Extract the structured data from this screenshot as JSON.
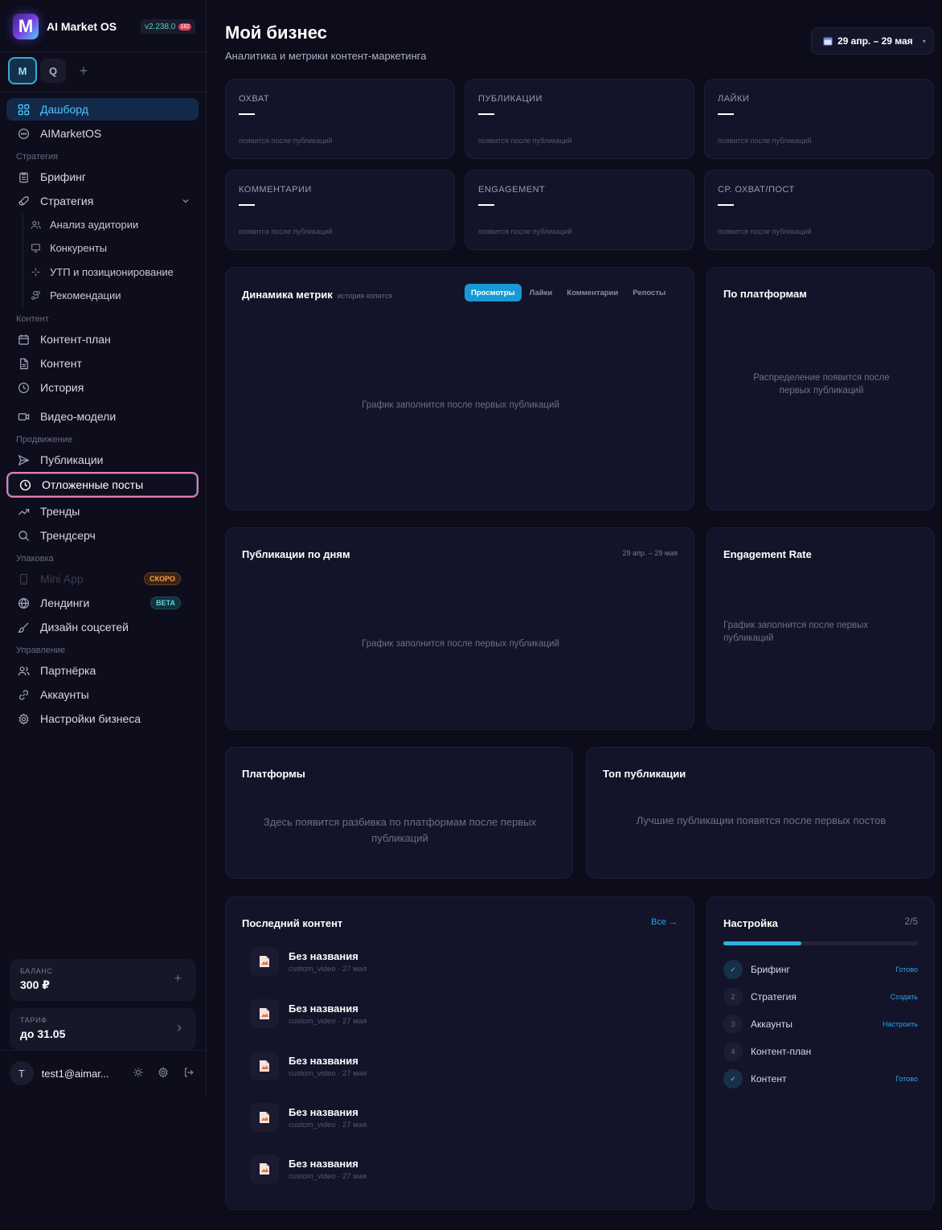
{
  "brand": {
    "logo": "M",
    "name": "AI Market OS",
    "version": "v2.238.0",
    "version_badge": "182"
  },
  "workspaces": {
    "active": "M",
    "other": "Q",
    "add": "+"
  },
  "nav": {
    "dashboard": "Дашборд",
    "aimarketos": "AIMarketOS",
    "section_strategy": "Стратегия",
    "briefing": "Брифинг",
    "strategy": "Стратегия",
    "audience": "Анализ аудитории",
    "competitors": "Конкуренты",
    "usp": "УТП и позиционирование",
    "recommendations": "Рекомендации",
    "section_content": "Контент",
    "content_plan": "Контент-план",
    "content": "Контент",
    "history": "История",
    "video_models": "Видео-модели",
    "section_promotion": "Продвижение",
    "publications": "Публикации",
    "scheduled": "Отложенные посты",
    "trends": "Тренды",
    "trendsearch": "Трендсерч",
    "section_packaging": "Упаковка",
    "mini_app": "Mini App",
    "mini_app_badge": "СКОРО",
    "landings": "Лендинги",
    "landings_badge": "BETA",
    "social_design": "Дизайн соцсетей",
    "section_management": "Управление",
    "partner": "Партнёрка",
    "accounts": "Аккаунты",
    "business_settings": "Настройки бизнеса"
  },
  "balance": {
    "label": "БАЛАНС",
    "value": "300 ₽",
    "action": "+"
  },
  "plan": {
    "label": "ТАРИФ",
    "value": "до 31.05",
    "action": "›"
  },
  "user": {
    "initial": "T",
    "email": "test1@aimar..."
  },
  "header": {
    "title": "Мой бизнес",
    "subtitle": "Аналитика и метрики контент-маркетинга",
    "date_range": "29 апр. – 29 мая"
  },
  "metrics": [
    {
      "label": "ОХВАТ",
      "hint": "появится после публикаций"
    },
    {
      "label": "ПУБЛИКАЦИИ",
      "hint": "появится после публикаций"
    },
    {
      "label": "ЛАЙКИ",
      "hint": "появится после публикаций"
    },
    {
      "label": "КОММЕНТАРИИ",
      "hint": "появится после публикаций"
    },
    {
      "label": "ENGAGEMENT",
      "hint": "появится после публикаций"
    },
    {
      "label": "СР. ОХВАТ/ПОСТ",
      "hint": "появится после публикаций"
    }
  ],
  "dynamics": {
    "title": "Динамика метрик",
    "note": "история копится",
    "tabs": [
      "Просмотры",
      "Лайки",
      "Комментарии",
      "Репосты"
    ],
    "empty": "График заполнится после первых публикаций"
  },
  "by_platforms": {
    "title": "По платформам",
    "empty": "Распределение появится после первых публикаций"
  },
  "by_days": {
    "title": "Публикации по дням",
    "range": "29 апр. – 29 мая",
    "empty": "График заполнится после первых публикаций"
  },
  "engagement": {
    "title": "Engagement Rate",
    "empty": "График заполнится после первых публикаций"
  },
  "platforms": {
    "title": "Платформы",
    "empty": "Здесь появится разбивка по платформам после первых публикаций"
  },
  "top": {
    "title": "Топ публикации",
    "empty": "Лучшие публикации появятся после первых постов"
  },
  "recent": {
    "title": "Последний контент",
    "all": "Все →",
    "items": [
      {
        "title": "Без названия",
        "meta": "custom_video · 27 мая"
      },
      {
        "title": "Без названия",
        "meta": "custom_video · 27 мая"
      },
      {
        "title": "Без названия",
        "meta": "custom_video · 27 мая"
      },
      {
        "title": "Без названия",
        "meta": "custom_video · 27 мая"
      },
      {
        "title": "Без названия",
        "meta": "custom_video · 27 мая"
      }
    ]
  },
  "setup": {
    "title": "Настройка",
    "count": "2/5",
    "progress": 0.4,
    "steps": [
      {
        "num": "✓",
        "label": "Брифинг",
        "status": "Готово"
      },
      {
        "num": "2",
        "label": "Стратегия",
        "status": "Создать"
      },
      {
        "num": "3",
        "label": "Аккаунты",
        "status": "Настроить"
      },
      {
        "num": "4",
        "label": "Контент-план",
        "status": ""
      },
      {
        "num": "✓",
        "label": "Контент",
        "status": "Готово"
      }
    ]
  }
}
